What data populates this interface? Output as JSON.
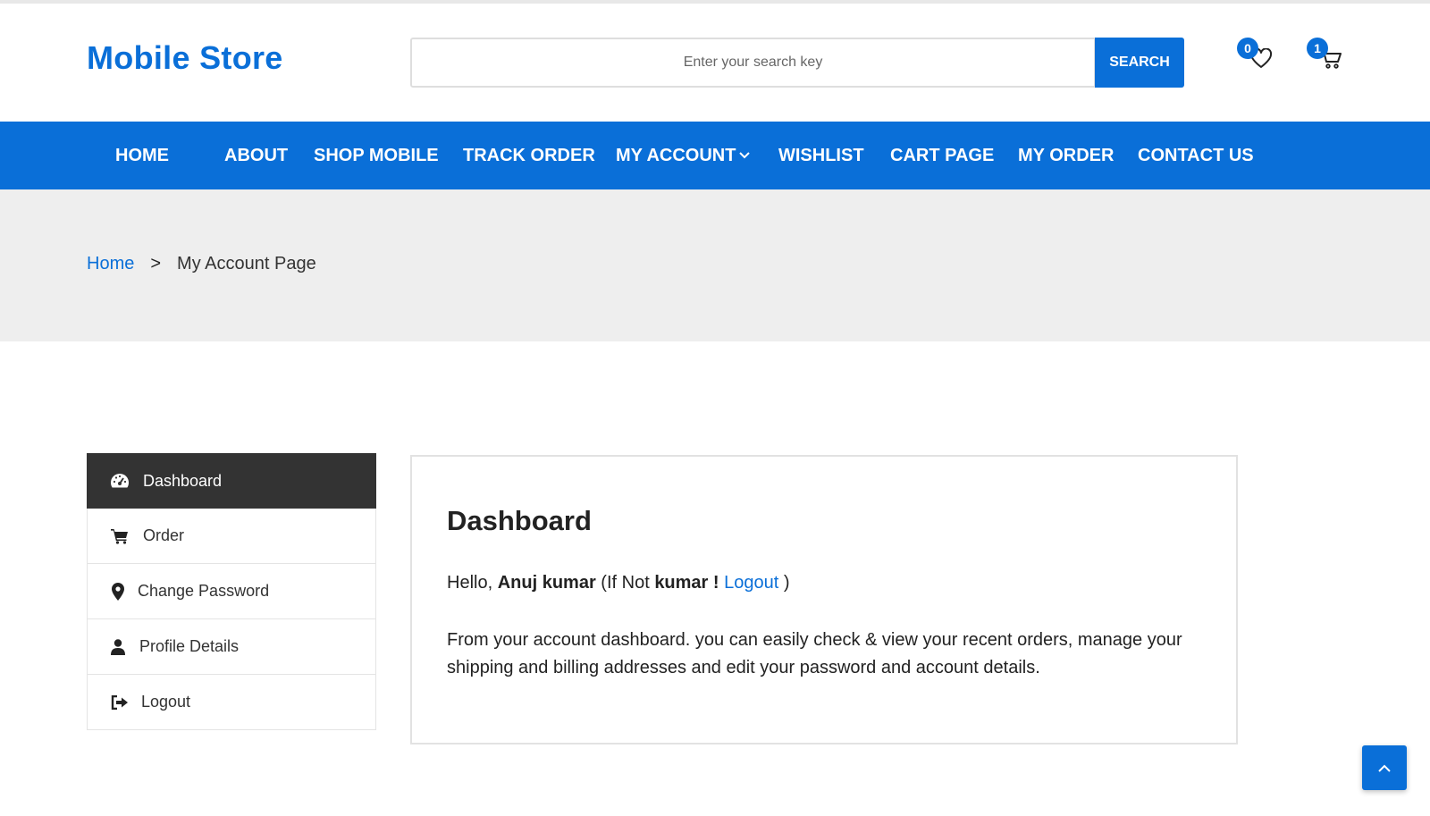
{
  "header": {
    "logo": "Mobile Store",
    "search_placeholder": "Enter your search key",
    "search_button": "SEARCH",
    "wishlist_count": "0",
    "cart_count": "1"
  },
  "nav": {
    "items": [
      {
        "label": "HOME"
      },
      {
        "label": "ABOUT"
      },
      {
        "label": "SHOP MOBILE"
      },
      {
        "label": "TRACK ORDER"
      },
      {
        "label": "MY ACCOUNT"
      },
      {
        "label": "WISHLIST"
      },
      {
        "label": "CART PAGE"
      },
      {
        "label": "MY ORDER"
      },
      {
        "label": "CONTACT US"
      }
    ]
  },
  "breadcrumb": {
    "home": "Home",
    "separator": ">",
    "current": "My Account Page"
  },
  "sidebar": {
    "items": [
      {
        "label": "Dashboard",
        "icon": "dashboard-gauge-icon",
        "active": true
      },
      {
        "label": "Order",
        "icon": "cart-icon"
      },
      {
        "label": "Change Password",
        "icon": "map-marker-icon"
      },
      {
        "label": "Profile Details",
        "icon": "user-icon"
      },
      {
        "label": "Logout",
        "icon": "sign-out-icon"
      }
    ]
  },
  "dashboard": {
    "title": "Dashboard",
    "hello_prefix": "Hello,",
    "user_name": "Anuj kumar",
    "if_not": "(If Not",
    "short_name": "kumar !",
    "logout_link": "Logout",
    "close_paren": ")",
    "description": "From your account dashboard. you can easily check & view your recent orders, manage your shipping and billing addresses and edit your password and account details."
  },
  "colors": {
    "brand_blue": "#0a6fd8",
    "active_sidebar": "#333333",
    "breadcrumb_bg": "#eeeeee"
  }
}
